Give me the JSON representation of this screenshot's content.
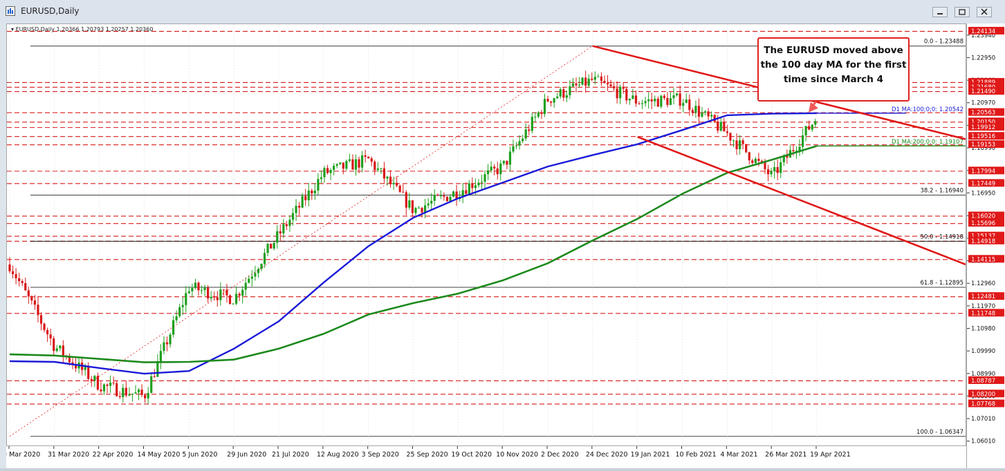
{
  "window": {
    "title": "EURUSD,Daily",
    "symbol_line": "EURUSD,Daily  1.20366 1.20793 1.20257 1.20360"
  },
  "annotation": {
    "text_lines": [
      "The EURUSD moved above",
      "the 100 day MA for the first",
      "time since March 4"
    ]
  },
  "colors": {
    "background": "#ffffff",
    "bull_candle": "#1ea01e",
    "bear_candle": "#d81818",
    "ma100": "#1a1ad8",
    "ma200": "#1c8a1c",
    "trendline": "#e01818",
    "level_line": "#d81818",
    "fib_line": "#000000",
    "price_tag": "#e01818"
  },
  "chart_data": {
    "type": "line",
    "title": "EURUSD,Daily",
    "ylim": [
      1.0595,
      1.2445
    ],
    "x_ticks": [
      "9 Mar 2020",
      "31 Mar 2020",
      "22 Apr 2020",
      "14 May 2020",
      "5 Jun 2020",
      "29 Jun 2020",
      "21 Jul 2020",
      "12 Aug 2020",
      "3 Sep 2020",
      "25 Sep 2020",
      "19 Oct 2020",
      "10 Nov 2020",
      "2 Dec 2020",
      "24 Dec 2020",
      "19 Jan 2021",
      "10 Feb 2021",
      "4 Mar 2021",
      "26 Mar 2021",
      "19 Apr 2021"
    ],
    "y_ticks": [
      1.2394,
      1.2295,
      1.2196,
      1.2097,
      1.1998,
      1.1899,
      1.18,
      1.1701,
      1.1601,
      1.1502,
      1.1403,
      1.1304,
      1.1205,
      1.1106,
      1.1007,
      1.0908,
      1.0809,
      1.071,
      1.0611
    ],
    "y_tick_labels": [
      "1.23940",
      "1.22950",
      "1.21960",
      "1.20970",
      "1.19980",
      "1.18990",
      "1.17990",
      "1.16950",
      "1.15990",
      "1.15010",
      "1.14020",
      "1.12960",
      "1.11970",
      "1.10980",
      "1.09990",
      "1.08990",
      "1.08000",
      "1.07010",
      "1.06010"
    ],
    "price_levels": [
      {
        "value": 1.24134,
        "label": "1.24134"
      },
      {
        "value": 1.21889,
        "label": "1.21889"
      },
      {
        "value": 1.2168,
        "label": "1.21680"
      },
      {
        "value": 1.2149,
        "label": "1.21490"
      },
      {
        "value": 1.20563,
        "label": "1.20563"
      },
      {
        "value": 1.2015,
        "label": "1.20150"
      },
      {
        "value": 1.19912,
        "label": "1.19912"
      },
      {
        "value": 1.19516,
        "label": "1.19516"
      },
      {
        "value": 1.19153,
        "label": "1.19153"
      },
      {
        "value": 1.17994,
        "label": "1.17994"
      },
      {
        "value": 1.17449,
        "label": "1.17449"
      },
      {
        "value": 1.1602,
        "label": "1.16020"
      },
      {
        "value": 1.15696,
        "label": "1.15696"
      },
      {
        "value": 1.15137,
        "label": "1.15137"
      },
      {
        "value": 1.14918,
        "label": "1.14918"
      },
      {
        "value": 1.14115,
        "label": "1.14115"
      },
      {
        "value": 1.12481,
        "label": "1.12481"
      },
      {
        "value": 1.11748,
        "label": "1.11748"
      },
      {
        "value": 1.08787,
        "label": "1.08787"
      },
      {
        "value": 1.082,
        "label": "1.08200"
      },
      {
        "value": 1.07768,
        "label": "1.07768"
      }
    ],
    "fib_levels": [
      {
        "label": "0.0 - 1.23488",
        "value": 1.23488
      },
      {
        "label": "38.2 - 1.16940",
        "value": 1.1694
      },
      {
        "label": "50.0 - 1.14918",
        "value": 1.14918
      },
      {
        "label": "61.8 - 1.12895",
        "value": 1.12895
      },
      {
        "label": "100.0 - 1.06347",
        "value": 1.06347
      }
    ],
    "ma_labels": [
      {
        "label": "D1 MA:100;0;0: 1.20542",
        "value": 1.20542
      },
      {
        "label": "D1 MA:200;0;0: 1.19107",
        "value": 1.19107
      }
    ],
    "current_price": 1.2036,
    "series": [
      {
        "name": "D1 MA:100;0;0",
        "points": [
          [
            "9 Mar 2020",
            1.0965
          ],
          [
            "31 Mar 2020",
            1.0962
          ],
          [
            "22 Apr 2020",
            1.0935
          ],
          [
            "14 May 2020",
            1.091
          ],
          [
            "5 Jun 2020",
            1.0922
          ],
          [
            "29 Jun 2020",
            1.102
          ],
          [
            "21 Jul 2020",
            1.114
          ],
          [
            "12 Aug 2020",
            1.131
          ],
          [
            "3 Sep 2020",
            1.147
          ],
          [
            "25 Sep 2020",
            1.1595
          ],
          [
            "19 Oct 2020",
            1.168
          ],
          [
            "10 Nov 2020",
            1.175
          ],
          [
            "2 Dec 2020",
            1.182
          ],
          [
            "24 Dec 2020",
            1.187
          ],
          [
            "19 Jan 2021",
            1.1918
          ],
          [
            "10 Feb 2021",
            1.198
          ],
          [
            "4 Mar 2021",
            1.2045
          ],
          [
            "26 Mar 2021",
            1.2052
          ],
          [
            "19 Apr 2021",
            1.2054
          ]
        ]
      },
      {
        "name": "D1 MA:200;0;0",
        "points": [
          [
            "9 Mar 2020",
            1.0995
          ],
          [
            "31 Mar 2020",
            1.099
          ],
          [
            "22 Apr 2020",
            1.0975
          ],
          [
            "14 May 2020",
            1.096
          ],
          [
            "5 Jun 2020",
            1.0962
          ],
          [
            "29 Jun 2020",
            1.0972
          ],
          [
            "21 Jul 2020",
            1.102
          ],
          [
            "12 Aug 2020",
            1.1085
          ],
          [
            "3 Sep 2020",
            1.117
          ],
          [
            "25 Sep 2020",
            1.122
          ],
          [
            "19 Oct 2020",
            1.1262
          ],
          [
            "10 Nov 2020",
            1.132
          ],
          [
            "2 Dec 2020",
            1.1395
          ],
          [
            "24 Dec 2020",
            1.1495
          ],
          [
            "19 Jan 2021",
            1.159
          ],
          [
            "10 Feb 2021",
            1.17
          ],
          [
            "4 Mar 2021",
            1.1792
          ],
          [
            "26 Mar 2021",
            1.185
          ],
          [
            "19 Apr 2021",
            1.191
          ]
        ]
      },
      {
        "name": "EURUSD close",
        "points": [
          [
            "9 Mar 2020",
            1.139
          ],
          [
            "31 Mar 2020",
            1.103
          ],
          [
            "22 Apr 2020",
            1.086
          ],
          [
            "14 May 2020",
            1.081
          ],
          [
            "5 Jun 2020",
            1.129
          ],
          [
            "29 Jun 2020",
            1.124
          ],
          [
            "21 Jul 2020",
            1.152
          ],
          [
            "12 Aug 2020",
            1.179
          ],
          [
            "3 Sep 2020",
            1.185
          ],
          [
            "25 Sep 2020",
            1.163
          ],
          [
            "19 Oct 2020",
            1.171
          ],
          [
            "10 Nov 2020",
            1.182
          ],
          [
            "2 Dec 2020",
            1.2115
          ],
          [
            "24 Dec 2020",
            1.22
          ],
          [
            "19 Jan 2021",
            1.2105
          ],
          [
            "10 Feb 2021",
            1.2115
          ],
          [
            "4 Mar 2021",
            1.1965
          ],
          [
            "26 Mar 2021",
            1.1775
          ],
          [
            "19 Apr 2021",
            1.2036
          ]
        ]
      }
    ],
    "trendlines": [
      {
        "from": [
          "24 Dec 2020",
          1.2349
        ],
        "to": [
          "right-edge",
          1.194
        ]
      },
      {
        "from": [
          "19 Jan 2021",
          1.195
        ],
        "to": [
          "right-edge",
          1.139
        ]
      },
      {
        "from": [
          "9 Mar 2020",
          1.0635
        ],
        "to": [
          "24 Dec 2020",
          1.2349
        ],
        "style": "dotted"
      }
    ]
  }
}
